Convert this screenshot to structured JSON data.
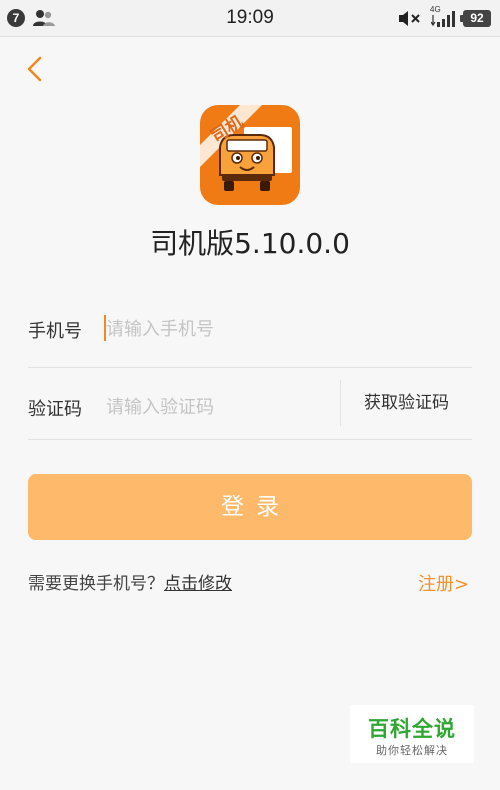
{
  "status_bar": {
    "notification_count": "7",
    "time": "19:09",
    "network": "4G",
    "battery": "92",
    "icons": [
      "users-icon",
      "mute-icon",
      "signal-icon",
      "battery-icon"
    ]
  },
  "nav": {
    "back_icon": "chevron-left-icon"
  },
  "app": {
    "logo_text": "司机",
    "logo_icon": "truck-icon",
    "title": "司机版5.10.0.0"
  },
  "form": {
    "phone_label": "手机号",
    "phone_placeholder": "请输入手机号",
    "phone_value": "",
    "code_label": "验证码",
    "code_placeholder": "请输入验证码",
    "code_value": "",
    "get_code_label": "获取验证码",
    "login_label": "登录"
  },
  "footer": {
    "change_phone_prompt": "需要更换手机号？",
    "change_phone_link": "点击修改",
    "register_label": "注册>"
  },
  "watermark": {
    "title": "百科全说",
    "subtitle": "助你轻松解决"
  },
  "colors": {
    "accent": "#f08a1e",
    "login_button": "#ffb96a",
    "logo_bg": "#f07a14",
    "watermark_green": "#2fa733"
  }
}
